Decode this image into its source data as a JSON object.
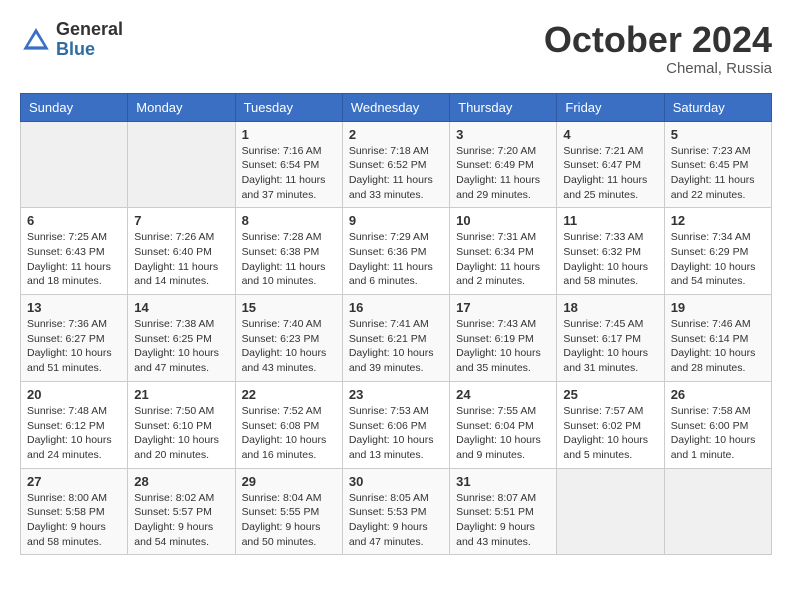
{
  "header": {
    "logo_general": "General",
    "logo_blue": "Blue",
    "month_title": "October 2024",
    "location": "Chemal, Russia"
  },
  "weekdays": [
    "Sunday",
    "Monday",
    "Tuesday",
    "Wednesday",
    "Thursday",
    "Friday",
    "Saturday"
  ],
  "weeks": [
    [
      {
        "day": "",
        "info": ""
      },
      {
        "day": "",
        "info": ""
      },
      {
        "day": "1",
        "info": "Sunrise: 7:16 AM\nSunset: 6:54 PM\nDaylight: 11 hours and 37 minutes."
      },
      {
        "day": "2",
        "info": "Sunrise: 7:18 AM\nSunset: 6:52 PM\nDaylight: 11 hours and 33 minutes."
      },
      {
        "day": "3",
        "info": "Sunrise: 7:20 AM\nSunset: 6:49 PM\nDaylight: 11 hours and 29 minutes."
      },
      {
        "day": "4",
        "info": "Sunrise: 7:21 AM\nSunset: 6:47 PM\nDaylight: 11 hours and 25 minutes."
      },
      {
        "day": "5",
        "info": "Sunrise: 7:23 AM\nSunset: 6:45 PM\nDaylight: 11 hours and 22 minutes."
      }
    ],
    [
      {
        "day": "6",
        "info": "Sunrise: 7:25 AM\nSunset: 6:43 PM\nDaylight: 11 hours and 18 minutes."
      },
      {
        "day": "7",
        "info": "Sunrise: 7:26 AM\nSunset: 6:40 PM\nDaylight: 11 hours and 14 minutes."
      },
      {
        "day": "8",
        "info": "Sunrise: 7:28 AM\nSunset: 6:38 PM\nDaylight: 11 hours and 10 minutes."
      },
      {
        "day": "9",
        "info": "Sunrise: 7:29 AM\nSunset: 6:36 PM\nDaylight: 11 hours and 6 minutes."
      },
      {
        "day": "10",
        "info": "Sunrise: 7:31 AM\nSunset: 6:34 PM\nDaylight: 11 hours and 2 minutes."
      },
      {
        "day": "11",
        "info": "Sunrise: 7:33 AM\nSunset: 6:32 PM\nDaylight: 10 hours and 58 minutes."
      },
      {
        "day": "12",
        "info": "Sunrise: 7:34 AM\nSunset: 6:29 PM\nDaylight: 10 hours and 54 minutes."
      }
    ],
    [
      {
        "day": "13",
        "info": "Sunrise: 7:36 AM\nSunset: 6:27 PM\nDaylight: 10 hours and 51 minutes."
      },
      {
        "day": "14",
        "info": "Sunrise: 7:38 AM\nSunset: 6:25 PM\nDaylight: 10 hours and 47 minutes."
      },
      {
        "day": "15",
        "info": "Sunrise: 7:40 AM\nSunset: 6:23 PM\nDaylight: 10 hours and 43 minutes."
      },
      {
        "day": "16",
        "info": "Sunrise: 7:41 AM\nSunset: 6:21 PM\nDaylight: 10 hours and 39 minutes."
      },
      {
        "day": "17",
        "info": "Sunrise: 7:43 AM\nSunset: 6:19 PM\nDaylight: 10 hours and 35 minutes."
      },
      {
        "day": "18",
        "info": "Sunrise: 7:45 AM\nSunset: 6:17 PM\nDaylight: 10 hours and 31 minutes."
      },
      {
        "day": "19",
        "info": "Sunrise: 7:46 AM\nSunset: 6:14 PM\nDaylight: 10 hours and 28 minutes."
      }
    ],
    [
      {
        "day": "20",
        "info": "Sunrise: 7:48 AM\nSunset: 6:12 PM\nDaylight: 10 hours and 24 minutes."
      },
      {
        "day": "21",
        "info": "Sunrise: 7:50 AM\nSunset: 6:10 PM\nDaylight: 10 hours and 20 minutes."
      },
      {
        "day": "22",
        "info": "Sunrise: 7:52 AM\nSunset: 6:08 PM\nDaylight: 10 hours and 16 minutes."
      },
      {
        "day": "23",
        "info": "Sunrise: 7:53 AM\nSunset: 6:06 PM\nDaylight: 10 hours and 13 minutes."
      },
      {
        "day": "24",
        "info": "Sunrise: 7:55 AM\nSunset: 6:04 PM\nDaylight: 10 hours and 9 minutes."
      },
      {
        "day": "25",
        "info": "Sunrise: 7:57 AM\nSunset: 6:02 PM\nDaylight: 10 hours and 5 minutes."
      },
      {
        "day": "26",
        "info": "Sunrise: 7:58 AM\nSunset: 6:00 PM\nDaylight: 10 hours and 1 minute."
      }
    ],
    [
      {
        "day": "27",
        "info": "Sunrise: 8:00 AM\nSunset: 5:58 PM\nDaylight: 9 hours and 58 minutes."
      },
      {
        "day": "28",
        "info": "Sunrise: 8:02 AM\nSunset: 5:57 PM\nDaylight: 9 hours and 54 minutes."
      },
      {
        "day": "29",
        "info": "Sunrise: 8:04 AM\nSunset: 5:55 PM\nDaylight: 9 hours and 50 minutes."
      },
      {
        "day": "30",
        "info": "Sunrise: 8:05 AM\nSunset: 5:53 PM\nDaylight: 9 hours and 47 minutes."
      },
      {
        "day": "31",
        "info": "Sunrise: 8:07 AM\nSunset: 5:51 PM\nDaylight: 9 hours and 43 minutes."
      },
      {
        "day": "",
        "info": ""
      },
      {
        "day": "",
        "info": ""
      }
    ]
  ]
}
